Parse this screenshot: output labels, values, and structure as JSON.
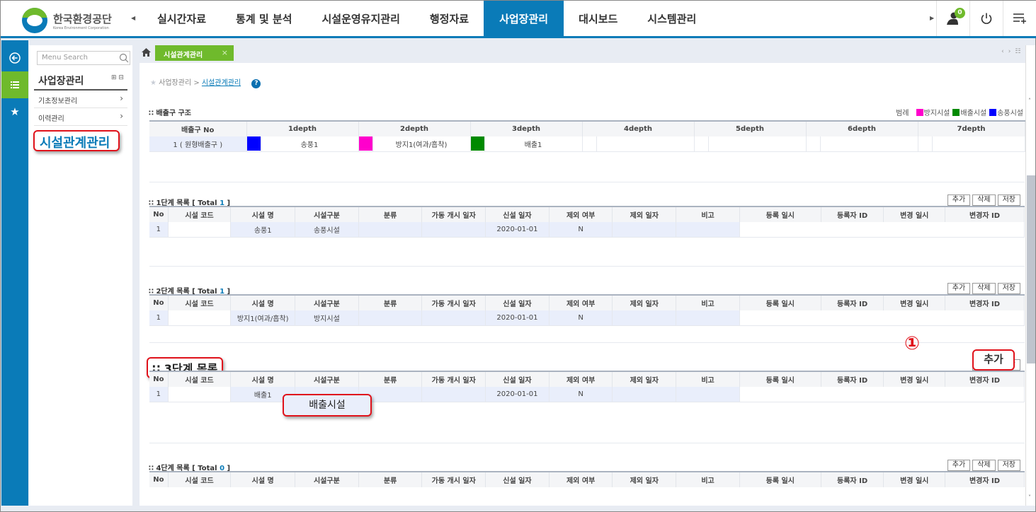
{
  "header": {
    "logo_title": "한국환경공단",
    "logo_subtitle": "Korea Environment Corporation",
    "menu": [
      {
        "label": "실시간자료",
        "active": false
      },
      {
        "label": "통계 및 분석",
        "active": false
      },
      {
        "label": "시설운영유지관리",
        "active": false
      },
      {
        "label": "행정자료",
        "active": false
      },
      {
        "label": "사업장관리",
        "active": true
      },
      {
        "label": "대시보드",
        "active": false
      },
      {
        "label": "시스템관리",
        "active": false
      }
    ],
    "notification_count": "0",
    "colors": {
      "primary": "#0a7bb8",
      "accent": "#6fba2c"
    }
  },
  "sidebar": {
    "search_placeholder": "Menu Search",
    "title": "사업장관리",
    "items": [
      {
        "label": "기초정보관리"
      },
      {
        "label": "이력관리"
      }
    ],
    "callout": "시설관계관리"
  },
  "tabs": [
    {
      "label": "시설관계관리"
    }
  ],
  "breadcrumb": {
    "parent": "사업장관리",
    "separator": ">",
    "current": "시설관계관리"
  },
  "structure": {
    "title": "배출구 구조",
    "legend_label": "범례",
    "legend": [
      {
        "label": "방지시설",
        "color": "#ff00cc"
      },
      {
        "label": "배출시설",
        "color": "#008a00"
      },
      {
        "label": "송풍시설",
        "color": "#0000ff"
      }
    ],
    "headers": [
      "배출구 No",
      "1depth",
      "2depth",
      "3depth",
      "4depth",
      "5depth",
      "6depth",
      "7depth"
    ],
    "row": {
      "no": "1 ( 원형배출구 )",
      "depths": [
        {
          "label": "송풍1",
          "color": "#0000ff"
        },
        {
          "label": "방지1(여과/흡착)",
          "color": "#ff00cc"
        },
        {
          "label": "배출1",
          "color": "#008a00"
        },
        {
          "label": "",
          "color": ""
        },
        {
          "label": "",
          "color": ""
        },
        {
          "label": "",
          "color": ""
        },
        {
          "label": "",
          "color": ""
        }
      ]
    }
  },
  "list_headers": [
    "No",
    "시설 코드",
    "시설 명",
    "시설구분",
    "분류",
    "가동 개시 일자",
    "신설 일자",
    "제외 여부",
    "제외 일자",
    "비고",
    "등록 일시",
    "등록자 ID",
    "변경 일시",
    "변경자 ID"
  ],
  "buttons": {
    "add": "추가",
    "delete": "삭제",
    "save": "저장"
  },
  "lists": [
    {
      "title": "1단계 목록",
      "total_label": "Total",
      "total": "1",
      "rows": [
        [
          "1",
          "",
          "송풍1",
          "송풍시설",
          "",
          "",
          "2020-01-01",
          "N",
          "",
          "",
          "",
          "",
          "",
          ""
        ]
      ]
    },
    {
      "title": "2단계 목록",
      "total_label": "Total",
      "total": "1",
      "rows": [
        [
          "1",
          "",
          "방지1(여과/흡착)",
          "방지시설",
          "",
          "",
          "2020-01-01",
          "N",
          "",
          "",
          "",
          "",
          "",
          ""
        ]
      ]
    },
    {
      "title": "3단계 목록",
      "rows": [
        [
          "1",
          "",
          "배출1",
          "",
          "",
          "",
          "2020-01-01",
          "N",
          "",
          "",
          "",
          "",
          "",
          ""
        ]
      ],
      "callout_category": "배출시설",
      "step_marker": "①"
    },
    {
      "title": "4단계 목록",
      "total_label": "Total",
      "total": "0",
      "rows": []
    }
  ]
}
